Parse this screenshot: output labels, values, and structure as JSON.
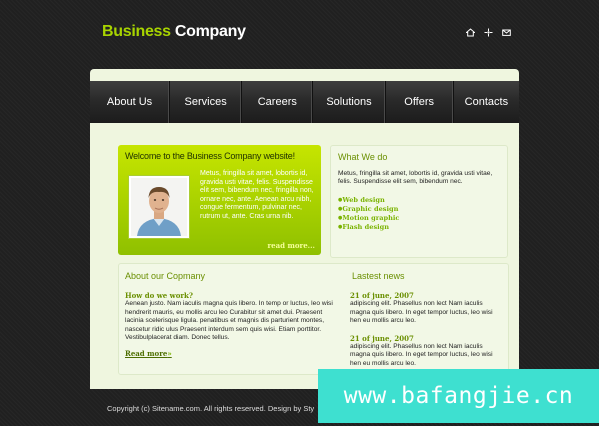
{
  "header": {
    "logo_part1": "Business",
    "logo_part2": "Company",
    "icons": [
      "home-icon",
      "sitemap-icon",
      "mail-icon"
    ]
  },
  "nav": {
    "items": [
      {
        "label": "About Us"
      },
      {
        "label": "Services"
      },
      {
        "label": "Careers"
      },
      {
        "label": "Solutions"
      },
      {
        "label": "Offers"
      },
      {
        "label": "Contacts"
      }
    ]
  },
  "welcome": {
    "title": "Welcome to the Business Company website!",
    "text": "Metus, fringilla sit amet, lobortis id, gravida usti vitae, felis. Suspendisse elit sem, bibendum nec, fringilla non, ornare nec, ante. Aenean arcu nibh, congue fermentum, pulvinar nec, rutrum ut, ante. Cras urna nib.",
    "read_more": "read more..."
  },
  "what_we_do": {
    "title": "What We do",
    "text": "Metus, fringilla sit amet, lobortis id, gravida usti vitae, felis. Suspendisse elit sem, bibendum nec.",
    "items": [
      "Web design",
      "Graphic design",
      "Motion graphic",
      "Flash design"
    ]
  },
  "about": {
    "title": "About our Copmany",
    "subtitle": "How do we work?",
    "text": "Aenean justo. Nam iaculis magna quis libero. In temp or luctus, leo wisi hendrerit mauris, eu mollis arcu leo Curabitur sit amet dui. Praesent lacinia scelerisque ligula. penatibus et magnis dis parturient montes, nascetur ridic ulus Praesent interdum sem quis wisi. Etiam porttitor. Vestibulplacerat diam. Donec tellus.",
    "read_more": "Read more",
    "arrow": "»"
  },
  "news": {
    "title": "Lastest news",
    "items": [
      {
        "date": "21 of june, 2007",
        "text": "adipiscing elit. Phasellus non lect Nam iaculis magna quis libero. In eget tempor luctus, leo wisi hen eu mollis arcu leo."
      },
      {
        "date": "21 of june, 2007",
        "text": "adipiscing elit. Phasellus non lect Nam iaculis magna quis libero. In eget tempor luctus, leo wisi hen eu mollis arcu leo."
      }
    ]
  },
  "footer": {
    "text": "Copyright (c) Sitename.com. All rights reserved. Design by Sty"
  },
  "watermark": {
    "text": "www.bafangjie.cn"
  },
  "colors": {
    "accent": "#a8d400",
    "background": "#222222",
    "content_bg": "#eff6df",
    "watermark": "#3ee0d0"
  }
}
